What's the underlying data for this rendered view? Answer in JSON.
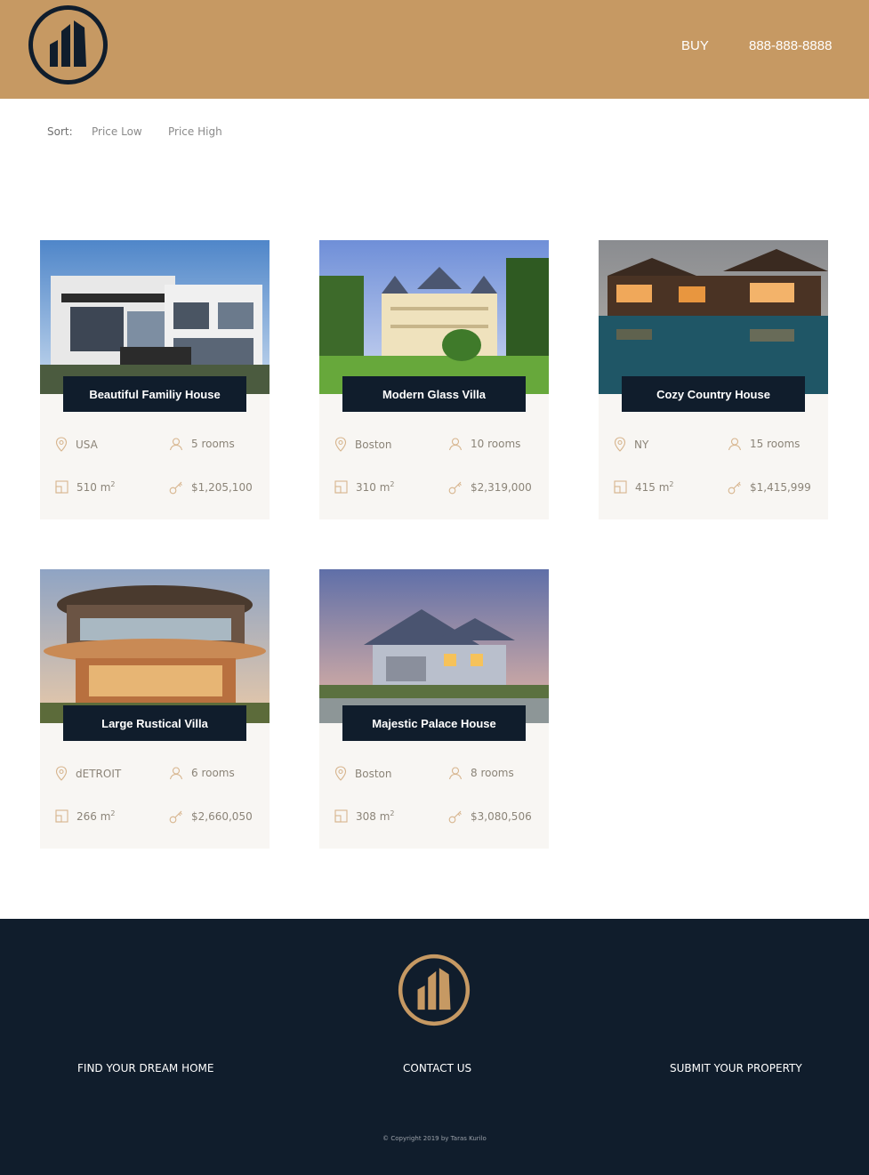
{
  "header": {
    "buy_label": "BUY",
    "phone": "888-888-8888",
    "logo_icon": "building-logo-icon"
  },
  "sort": {
    "label": "Sort:",
    "options": [
      "Price Low",
      "Price High"
    ]
  },
  "properties": [
    {
      "title": "Beautiful Familiy House",
      "location": "USA",
      "rooms": "5 rooms",
      "area": "510 m",
      "area_unit_exp": "2",
      "price": "$1,205,100"
    },
    {
      "title": "Modern Glass Villa",
      "location": "Boston",
      "rooms": "10 rooms",
      "area": "310 m",
      "area_unit_exp": "2",
      "price": "$2,319,000"
    },
    {
      "title": "Cozy Country House",
      "location": "NY",
      "rooms": "15 rooms",
      "area": "415 m",
      "area_unit_exp": "2",
      "price": "$1,415,999"
    },
    {
      "title": "Large Rustical Villa",
      "location": "dETROIT",
      "rooms": "6 rooms",
      "area": "266 m",
      "area_unit_exp": "2",
      "price": "$2,660,050"
    },
    {
      "title": "Majestic Palace House",
      "location": "Boston",
      "rooms": "8 rooms",
      "area": "308 m",
      "area_unit_exp": "2",
      "price": "$3,080,506"
    }
  ],
  "icons": {
    "location": "map-pin-icon",
    "rooms": "user-icon",
    "area": "area-icon",
    "price": "key-icon"
  },
  "footer": {
    "links": [
      "FIND YOUR DREAM HOME",
      "CONTACT US",
      "SUBMIT YOUR PROPERTY"
    ],
    "copyright": "© Copyright 2019 by Taras Kurilo"
  },
  "colors": {
    "brand": "#c69963",
    "dark": "#101d2c",
    "card_bg": "#f8f6f3"
  }
}
